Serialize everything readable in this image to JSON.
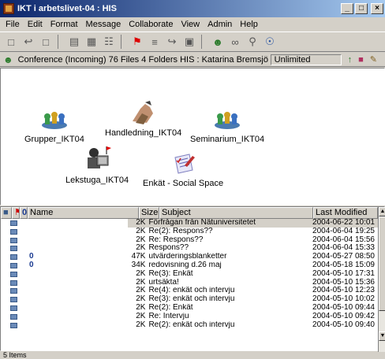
{
  "window": {
    "title": "IKT i arbetslivet-04 : HIS",
    "minimize": "_",
    "maximize": "□",
    "close": "×"
  },
  "menu": [
    "File",
    "Edit",
    "Format",
    "Message",
    "Collaborate",
    "View",
    "Admin",
    "Help"
  ],
  "toolbar_icons": [
    "new-document-icon",
    "reply-icon",
    "new-message-icon",
    "print-icon",
    "delete-icon",
    "move-icon",
    "flag-icon",
    "tree-icon",
    "forward-icon",
    "folder-icon",
    "users-icon",
    "binoculars-icon",
    "search-icon",
    "connect-icon"
  ],
  "status": {
    "path": "Conference (Incoming)  76 Files  4 Folders   HIS : Katarina Bremsjö",
    "quota": "Unlimited"
  },
  "folders": [
    {
      "name": "Grupper_IKT04",
      "icon": "group-icon"
    },
    {
      "name": "Handledning_IKT04",
      "icon": "handshake-icon"
    },
    {
      "name": "Seminarium_IKT04",
      "icon": "group-icon"
    },
    {
      "name": "Lekstuga_IKT04",
      "icon": "computer-user-icon"
    },
    {
      "name": "Enkät - Social Space",
      "icon": "form-icon"
    }
  ],
  "list": {
    "columns": {
      "name": "Name",
      "size": "Size",
      "subject": "Subject",
      "modified": "Last Modified"
    },
    "rows": [
      {
        "size": "2K",
        "subject": "Förfrågan från Nätuniversitetet",
        "date": "2004-06-22 10:01",
        "attach": false,
        "selected": true
      },
      {
        "size": "2K",
        "subject": "Re(2): Respons??",
        "date": "2004-06-04 19:25",
        "attach": false
      },
      {
        "size": "2K",
        "subject": "Re: Respons??",
        "date": "2004-06-04 15:56",
        "attach": false
      },
      {
        "size": "2K",
        "subject": "Respons??",
        "date": "2004-06-04 15:33",
        "attach": false
      },
      {
        "size": "47K",
        "subject": "utvärderingsblanketter",
        "date": "2004-05-27 08:50",
        "attach": true
      },
      {
        "size": "34K",
        "subject": "redovisning d.26 maj",
        "date": "2004-05-18 15:09",
        "attach": true
      },
      {
        "size": "2K",
        "subject": "Re(3): Enkät",
        "date": "2004-05-10 17:31",
        "attach": false
      },
      {
        "size": "2K",
        "subject": "urtsäkta!",
        "date": "2004-05-10 15:36",
        "attach": false
      },
      {
        "size": "2K",
        "subject": "Re(4): enkät och intervju",
        "date": "2004-05-10 12:23",
        "attach": false
      },
      {
        "size": "2K",
        "subject": "Re(3): enkät och intervju",
        "date": "2004-05-10 10:02",
        "attach": false
      },
      {
        "size": "2K",
        "subject": "Re(2): Enkät",
        "date": "2004-05-10 09:44",
        "attach": false
      },
      {
        "size": "2K",
        "subject": "Re: Intervju",
        "date": "2004-05-10 09:42",
        "attach": false
      },
      {
        "size": "2K",
        "subject": "Re(2): enkät och intervju",
        "date": "2004-05-10 09:40",
        "attach": false
      }
    ]
  },
  "footer": "5 Items"
}
